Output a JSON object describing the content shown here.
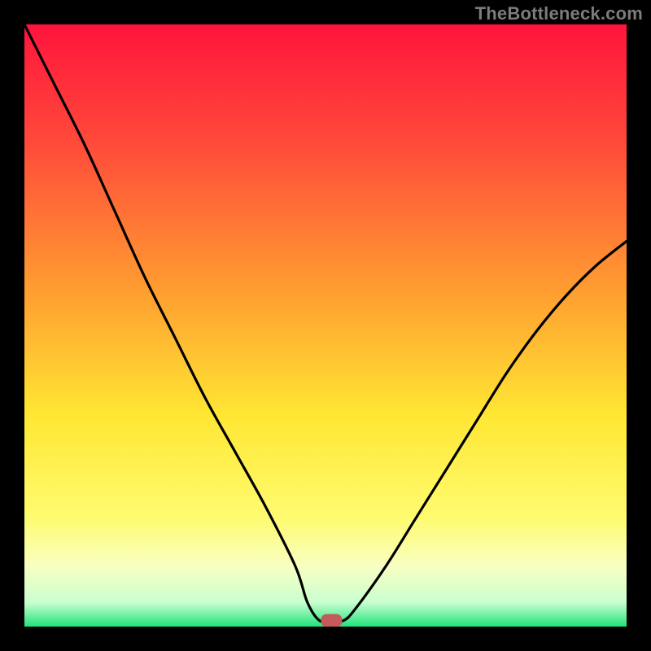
{
  "watermark": "TheBottleneck.com",
  "chart_data": {
    "type": "line",
    "title": "",
    "xlabel": "",
    "ylabel": "",
    "xlim": [
      0,
      100
    ],
    "ylim": [
      0,
      100
    ],
    "grid": false,
    "series": [
      {
        "name": "curve",
        "x": [
          0,
          5,
          10,
          15,
          20,
          25,
          30,
          35,
          40,
          45,
          47,
          49,
          51,
          53,
          55,
          60,
          65,
          70,
          75,
          80,
          85,
          90,
          95,
          100
        ],
        "y": [
          100,
          90,
          80,
          69,
          58,
          48,
          38,
          29,
          20,
          10,
          4,
          1,
          1,
          1,
          3,
          10,
          18,
          26,
          34,
          42,
          49,
          55,
          60,
          64
        ]
      }
    ],
    "marker": {
      "x": 51,
      "y": 1
    },
    "gradient_stops": [
      {
        "offset": 0.0,
        "color": "#ff143c"
      },
      {
        "offset": 0.2,
        "color": "#ff4b3a"
      },
      {
        "offset": 0.45,
        "color": "#ffa030"
      },
      {
        "offset": 0.65,
        "color": "#ffe733"
      },
      {
        "offset": 0.82,
        "color": "#fffb70"
      },
      {
        "offset": 0.9,
        "color": "#f8ffc2"
      },
      {
        "offset": 0.96,
        "color": "#c9ffd0"
      },
      {
        "offset": 1.0,
        "color": "#21e37a"
      }
    ]
  }
}
